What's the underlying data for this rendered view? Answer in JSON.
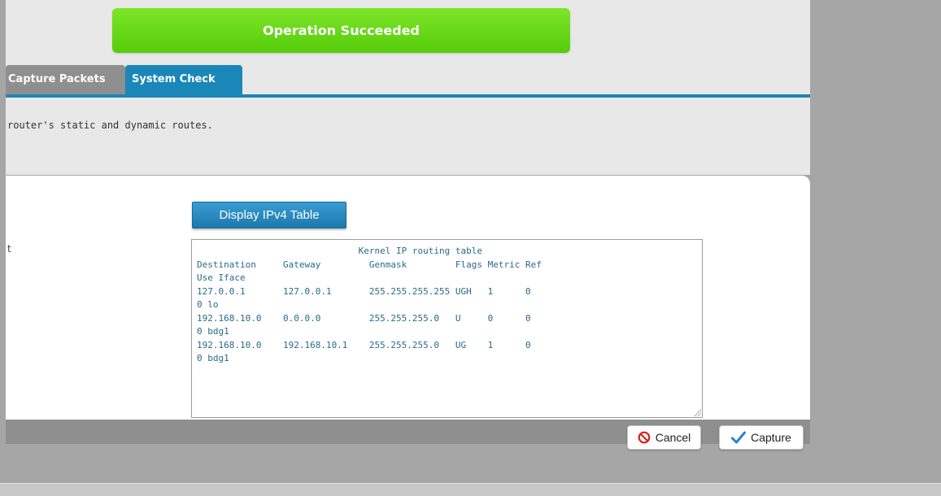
{
  "notification": {
    "message": "Operation Succeeded"
  },
  "tabs": [
    {
      "label": "Capture Packets",
      "active": false
    },
    {
      "label": "System Check",
      "active": true
    }
  ],
  "description": "router's static and dynamic routes.",
  "row_label_fragment": "t",
  "display_button_label": "Display IPv4 Table",
  "routing_table_text": "                              Kernel IP routing table\nDestination     Gateway         Genmask         Flags Metric Ref\nUse Iface\n127.0.0.1       127.0.0.1       255.255.255.255 UGH   1      0\n0 lo\n192.168.10.0    0.0.0.0         255.255.255.0   U     0      0\n0 bdg1\n192.168.10.0    192.168.10.1    255.255.255.0   UG    1      0\n0 bdg1",
  "actions": {
    "cancel_label": "Cancel",
    "capture_label": "Capture"
  },
  "colors": {
    "accent": "#1b87b9",
    "success": "#66d91a",
    "cancel_icon": "#d9221f",
    "capture_icon": "#2f7fd1"
  },
  "icons": {
    "cancel": "no-entry-icon",
    "capture": "checkmark-icon"
  }
}
